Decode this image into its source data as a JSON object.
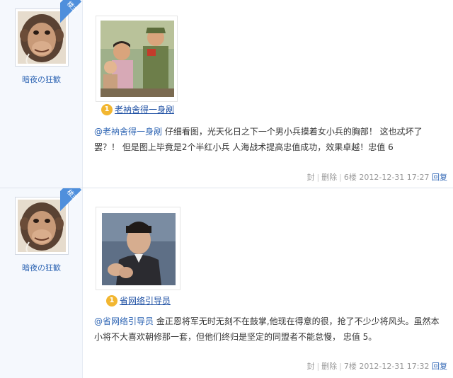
{
  "posts": [
    {
      "author": "暗夜の狂歓",
      "badge": "楼主",
      "image_caption": "老衲舍得一身剐",
      "mention": "@老衲舍得一身剐",
      "body_line1_rest": " 仔细看图，光天化日之下一个男小兵摸着女小兵的胸部！ 这也忒坏了",
      "body_line2": "罢？！ 但是图上毕竟是2个半红小兵 人海战术提高忠值成功，效果卓越！忠值 6",
      "actions": [
        "封",
        "删除"
      ],
      "floor": "6楼",
      "timestamp": "2012-12-31 17:27",
      "reply_label": "回复"
    },
    {
      "author": "暗夜の狂歓",
      "badge": "楼主",
      "image_caption": "省网络引导员",
      "mention": "@省网络引导员",
      "body_line1_rest": " 金正恩将军无时无刻不在鼓掌,他现在得意的很，抢了不少少将风头。虽然本",
      "body_line2": "小将不大喜欢朝修那一套，但他们终归是坚定的同盟者不能怠慢，  忠值 5。",
      "actions": [
        "封",
        "删除"
      ],
      "floor": "7楼",
      "timestamp": "2012-12-31 17:32",
      "reply_label": "回复"
    }
  ],
  "icons": {
    "medal": "rank-1-medal-icon",
    "avatar": "monkey-avatar"
  },
  "colors": {
    "link": "#2d64b3",
    "badge": "#4f8fdc",
    "sidebar_bg": "#f5f8fd",
    "meta_text": "#999999"
  }
}
